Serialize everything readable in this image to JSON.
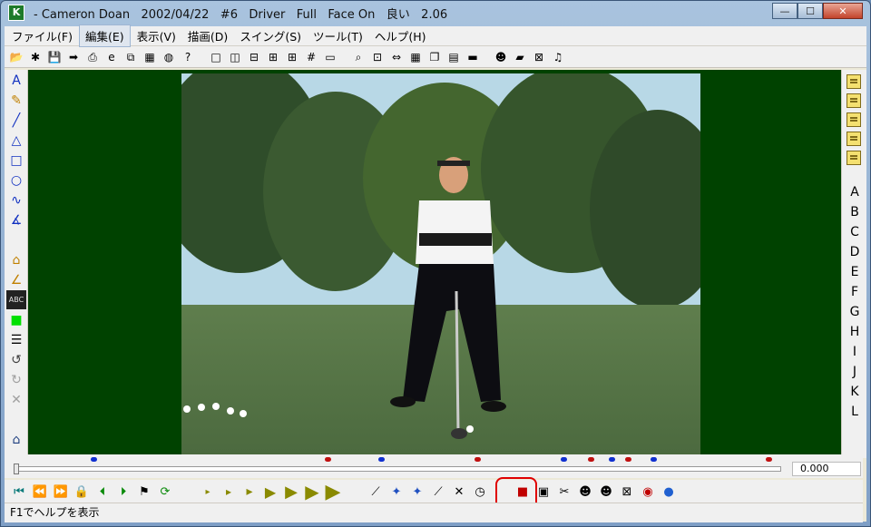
{
  "window": {
    "title": "- Cameron Doan   2002/04/22   #6   Driver   Full   Face On   良い   2.06",
    "minimize_glyph": "—",
    "maximize_glyph": "☐",
    "close_glyph": "✕"
  },
  "menubar": {
    "items": [
      {
        "label": "ファイル(F)"
      },
      {
        "label": "編集(E)"
      },
      {
        "label": "表示(V)"
      },
      {
        "label": "描画(D)"
      },
      {
        "label": "スイング(S)"
      },
      {
        "label": "ツール(T)"
      },
      {
        "label": "ヘルプ(H)"
      }
    ]
  },
  "toolbar": {
    "icons": [
      "open-icon",
      "new-icon",
      "save-icon",
      "arrow-icon",
      "print-icon",
      "ie-icon",
      "copy-icon",
      "film-icon",
      "ball-icon",
      "help-icon",
      "sep",
      "layout-single-icon",
      "layout-split-vertical-icon",
      "layout-split-horizontal-icon",
      "layout-three-icon",
      "layout-quad-icon",
      "layout-grid-icon",
      "monitor-icon",
      "sep",
      "zoom-icon",
      "fit-icon",
      "split-arrows-icon",
      "grid-icon",
      "window-icon",
      "stack-icon",
      "film-strip-icon",
      "sep",
      "person-icon",
      "book-icon",
      "excel-icon",
      "music-icon"
    ]
  },
  "leftbar": {
    "icons": [
      {
        "name": "text-icon",
        "glyph": "A",
        "color": "#1030c0"
      },
      {
        "name": "pencil-icon",
        "glyph": "✎",
        "color": "#c08000"
      },
      {
        "name": "line-icon",
        "glyph": "╱",
        "color": "#1030c0"
      },
      {
        "name": "triangle-icon",
        "glyph": "△",
        "color": "#1030c0"
      },
      {
        "name": "rectangle-icon",
        "glyph": "□",
        "color": "#1030c0"
      },
      {
        "name": "circle-icon",
        "glyph": "○",
        "color": "#1030c0"
      },
      {
        "name": "curve-icon",
        "glyph": "∿",
        "color": "#1030c0"
      },
      {
        "name": "angle-icon",
        "glyph": "∡",
        "color": "#1030c0"
      },
      {
        "name": "gap",
        "glyph": "",
        "color": ""
      },
      {
        "name": "shape-icon",
        "glyph": "⌂",
        "color": "#c08000"
      },
      {
        "name": "angle-tool-icon",
        "glyph": "∠",
        "color": "#c08000"
      },
      {
        "name": "abc-label-icon",
        "glyph": "ABC",
        "color": "#e0e0e0"
      },
      {
        "name": "color-swatch-icon",
        "glyph": "■",
        "color": "#00e000"
      },
      {
        "name": "line-width-icon",
        "glyph": "☰",
        "color": "#000000"
      },
      {
        "name": "undo-icon",
        "glyph": "↺",
        "color": "#404040"
      },
      {
        "name": "redo-icon",
        "glyph": "↻",
        "color": "#a0a0a0"
      },
      {
        "name": "delete-icon",
        "glyph": "✕",
        "color": "#a0a0a0"
      },
      {
        "name": "gap",
        "glyph": "",
        "color": ""
      },
      {
        "name": "building-icon",
        "glyph": "⌂",
        "color": "#204080"
      }
    ]
  },
  "rightbar": {
    "docs": [
      "doc-1-icon",
      "doc-2-icon",
      "doc-3-icon",
      "doc-4-icon",
      "doc-5-icon"
    ],
    "letters": [
      "A",
      "B",
      "C",
      "D",
      "E",
      "F",
      "G",
      "H",
      "I",
      "J",
      "K",
      "L"
    ]
  },
  "timeline": {
    "time": "0.000",
    "markers": [
      {
        "pos": 0.1,
        "color": "#1030d0"
      },
      {
        "pos": 0.405,
        "color": "#c01010"
      },
      {
        "pos": 0.475,
        "color": "#1030d0"
      },
      {
        "pos": 0.6,
        "color": "#c01010"
      },
      {
        "pos": 0.713,
        "color": "#1030d0"
      },
      {
        "pos": 0.748,
        "color": "#c01010"
      },
      {
        "pos": 0.775,
        "color": "#1030d0"
      },
      {
        "pos": 0.797,
        "color": "#c01010"
      },
      {
        "pos": 0.83,
        "color": "#1030d0"
      },
      {
        "pos": 0.98,
        "color": "#c01010"
      }
    ]
  },
  "bottombar": {
    "icons": [
      "first-frame-icon",
      "prev-fast-icon",
      "next-fast-icon",
      "lock-icon",
      "prev-key-icon",
      "next-key-icon",
      "marker-icon",
      "loop-icon",
      "sep",
      "play-speed-1-icon",
      "play-speed-2-icon",
      "play-speed-3-icon",
      "play-speed-4-icon",
      "play-speed-5-icon",
      "play-speed-6-icon",
      "play-speed-7-icon",
      "sep",
      "draw-tool-1-icon",
      "draw-tool-2-icon",
      "draw-tool-3-icon",
      "draw-tool-4-icon",
      "draw-tool-5-icon",
      "clock-icon",
      "sep",
      "camera-icon",
      "movie-icon",
      "scissors-icon",
      "person-compare-icon",
      "person-overlay-icon",
      "x-frame-icon",
      "play-circle-icon",
      "color-balls-icon"
    ]
  },
  "status": {
    "text": "F1でヘルプを表示"
  }
}
